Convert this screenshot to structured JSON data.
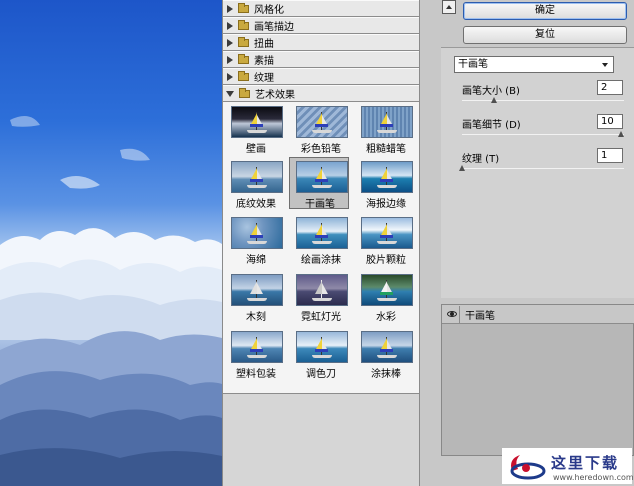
{
  "gallery": {
    "categories": [
      {
        "label": "风格化"
      },
      {
        "label": "画笔描边"
      },
      {
        "label": "扭曲"
      },
      {
        "label": "素描"
      },
      {
        "label": "纹理"
      },
      {
        "label": "艺术效果"
      }
    ],
    "filters": [
      {
        "label": "壁画"
      },
      {
        "label": "彩色铅笔"
      },
      {
        "label": "粗糙蜡笔"
      },
      {
        "label": "底纹效果"
      },
      {
        "label": "干画笔"
      },
      {
        "label": "海报边缘"
      },
      {
        "label": "海绵"
      },
      {
        "label": "绘画涂抹"
      },
      {
        "label": "胶片颗粒"
      },
      {
        "label": "木刻"
      },
      {
        "label": "霓虹灯光"
      },
      {
        "label": "水彩"
      },
      {
        "label": "塑料包装"
      },
      {
        "label": "调色刀"
      },
      {
        "label": "涂抹棒"
      }
    ],
    "selected_filter": "干画笔"
  },
  "buttons": {
    "ok": "确定",
    "reset": "复位"
  },
  "settings": {
    "filter_select": "干画笔",
    "params": [
      {
        "label": "画笔大小 (B)",
        "value": "2",
        "fraction": 0.2
      },
      {
        "label": "画笔细节 (D)",
        "value": "10",
        "fraction": 1.0
      },
      {
        "label": "纹理 (T)",
        "value": "1",
        "fraction": 0.0
      }
    ]
  },
  "layers": {
    "active_layer": "干画笔"
  },
  "watermark": {
    "name": "这里下载",
    "url": "www.heredown.com"
  }
}
